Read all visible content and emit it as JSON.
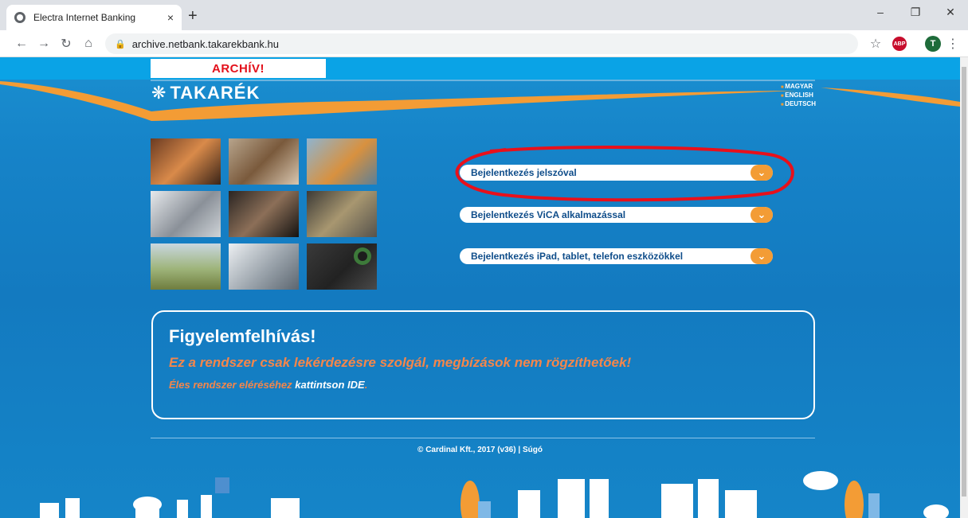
{
  "browser": {
    "tab_title": "Electra Internet Banking",
    "tab_close": "×",
    "new_tab": "+",
    "url": "archive.netbank.takarekbank.hu",
    "win_minimize": "–",
    "win_restore": "❐",
    "win_close": "✕",
    "abp_label": "ABP",
    "profile_initial": "T"
  },
  "header": {
    "archive_label": "ARCHÍV!",
    "logo_text": "TAKARÉK",
    "languages": [
      "MAGYAR",
      "ENGLISH",
      "DEUTSCH"
    ]
  },
  "login_options": [
    "Bejelentkezés jelszóval",
    "Bejelentkezés ViCA alkalmazással",
    "Bejelentkezés iPad, tablet, telefon eszközökkel"
  ],
  "notice": {
    "heading": "Figyelemfelhívás!",
    "warning": "Ez a rendszer csak lekérdezésre szolgál, megbízások nem rögzíthetőek!",
    "live_prefix": "Éles rendszer eléréséhez",
    "live_link": "kattintson IDE",
    "live_suffix": "."
  },
  "footer": {
    "copyright": "© Cardinal Kft., 2017 (v36) |",
    "help_link": "Súgó"
  },
  "colors": {
    "brand_blue": "#1683c8",
    "accent_orange": "#f39c35",
    "archive_red": "#e3101b",
    "highlight_red": "#e8101b"
  }
}
